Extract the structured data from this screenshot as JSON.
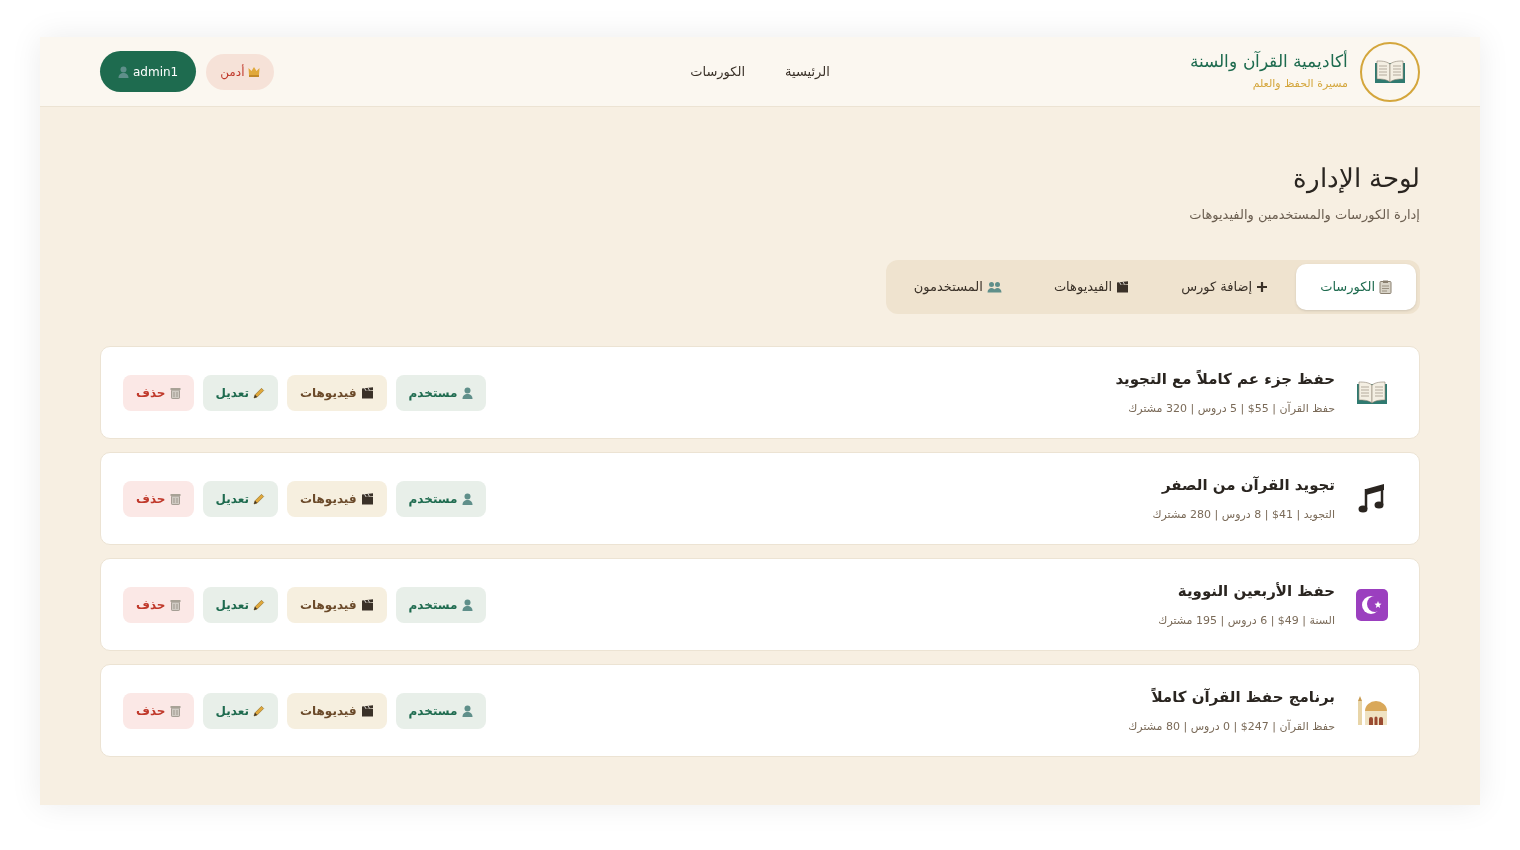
{
  "header": {
    "logo_title": "أكاديمية القرآن والسنة",
    "logo_subtitle": "مسيرة الحفظ والعلم",
    "nav": [
      {
        "label": "الرئيسية"
      },
      {
        "label": "الكورسات"
      }
    ],
    "role_badge": "أدمن",
    "user_button": "admin1"
  },
  "page": {
    "title": "لوحة الإدارة",
    "subtitle": "إدارة الكورسات والمستخدمين والفيديوهات"
  },
  "tabs": [
    {
      "kind": "clipboard",
      "label": "الكورسات",
      "selected": true
    },
    {
      "kind": "plus",
      "label": "إضافة كورس",
      "selected": false
    },
    {
      "kind": "clapper",
      "label": "الفيديوهات",
      "selected": false
    },
    {
      "kind": "users",
      "label": "المستخدمون",
      "selected": false
    }
  ],
  "courses": [
    {
      "kind": "book",
      "title": "حفظ جزء عم كاملاً مع التجويد",
      "meta": "حفظ القرآن | 55$ | 5 دروس | 320 مشترك",
      "actions": [
        {
          "kind": "user",
          "label": "مستخدم"
        },
        {
          "kind": "videos",
          "label": "فيديوهات"
        },
        {
          "kind": "edit",
          "label": "تعديل"
        },
        {
          "kind": "delete",
          "label": "حذف"
        }
      ]
    },
    {
      "kind": "music",
      "title": "تجويد القرآن من الصفر",
      "meta": "التجويد | 41$ | 8 دروس | 280 مشترك",
      "actions": [
        {
          "kind": "user",
          "label": "مستخدم"
        },
        {
          "kind": "videos",
          "label": "فيديوهات"
        },
        {
          "kind": "edit",
          "label": "تعديل"
        },
        {
          "kind": "delete",
          "label": "حذف"
        }
      ]
    },
    {
      "kind": "crescent",
      "title": "حفظ الأربعين النووية",
      "meta": "السنة | 49$ | 6 دروس | 195 مشترك",
      "actions": [
        {
          "kind": "user",
          "label": "مستخدم"
        },
        {
          "kind": "videos",
          "label": "فيديوهات"
        },
        {
          "kind": "edit",
          "label": "تعديل"
        },
        {
          "kind": "delete",
          "label": "حذف"
        }
      ]
    },
    {
      "kind": "mosque",
      "title": "برنامج حفظ القرآن كاملاً",
      "meta": "حفظ القرآن | 247$ | 0 دروس | 80 مشترك",
      "actions": [
        {
          "kind": "user",
          "label": "مستخدم"
        },
        {
          "kind": "videos",
          "label": "فيديوهات"
        },
        {
          "kind": "edit",
          "label": "تعديل"
        },
        {
          "kind": "delete",
          "label": "حذف"
        }
      ]
    }
  ]
}
